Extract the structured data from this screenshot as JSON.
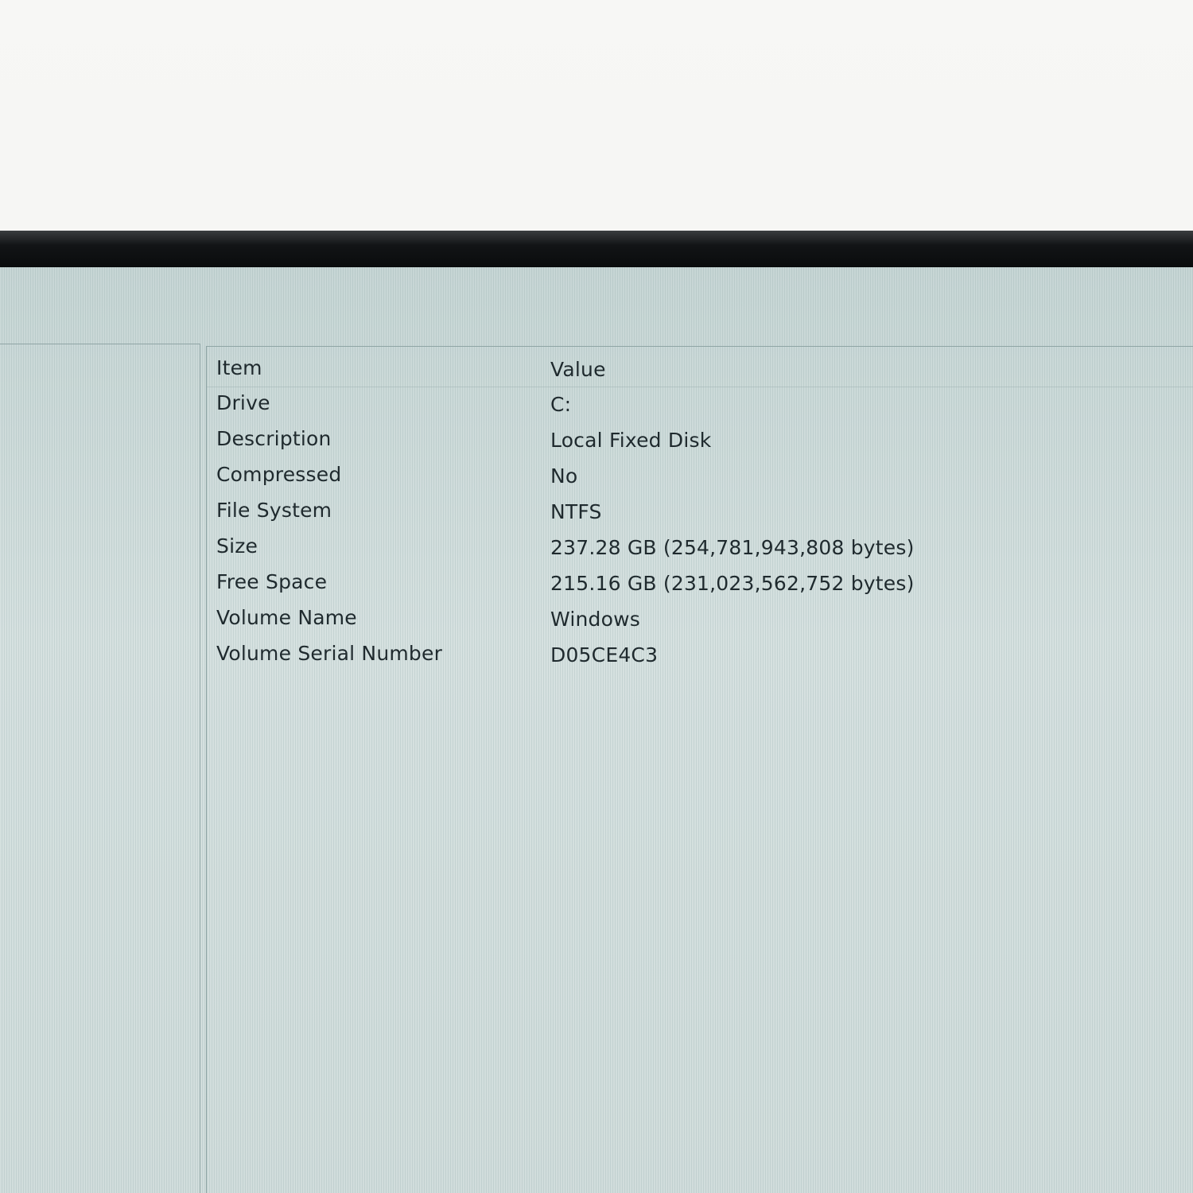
{
  "table": {
    "headers": {
      "item": "Item",
      "value": "Value"
    },
    "rows": [
      {
        "item": "Drive",
        "value": "C:"
      },
      {
        "item": "Description",
        "value": "Local Fixed Disk"
      },
      {
        "item": "Compressed",
        "value": "No"
      },
      {
        "item": "File System",
        "value": "NTFS"
      },
      {
        "item": "Size",
        "value": "237.28 GB (254,781,943,808 bytes)"
      },
      {
        "item": "Free Space",
        "value": "215.16 GB (231,023,562,752 bytes)"
      },
      {
        "item": "Volume Name",
        "value": "Windows"
      },
      {
        "item": "Volume Serial Number",
        "value": "D05CE4C3"
      }
    ]
  },
  "colors": {
    "screen_background": "#cfdcdb",
    "text": "#1f2a2e",
    "divider": "#8fa5a5"
  }
}
